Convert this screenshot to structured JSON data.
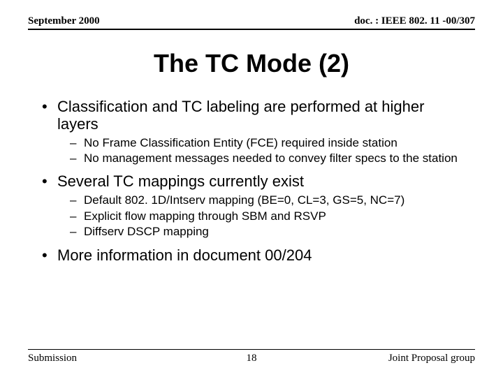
{
  "header": {
    "left": "September 2000",
    "right": "doc. : IEEE 802. 11 -00/307"
  },
  "title": "The TC Mode (2)",
  "bullets": [
    {
      "text": "Classification and TC labeling are performed at higher layers",
      "sub": [
        "No Frame Classification Entity (FCE) required inside station",
        "No management messages needed to convey filter specs to the station"
      ]
    },
    {
      "text": "Several TC mappings currently exist",
      "sub": [
        "Default 802. 1D/Intserv mapping (BE=0, CL=3, GS=5, NC=7)",
        "Explicit flow mapping through SBM and RSVP",
        "Diffserv DSCP mapping"
      ]
    },
    {
      "text": "More information in document 00/204",
      "sub": []
    }
  ],
  "footer": {
    "left": "Submission",
    "center": "18",
    "right": "Joint Proposal group"
  }
}
